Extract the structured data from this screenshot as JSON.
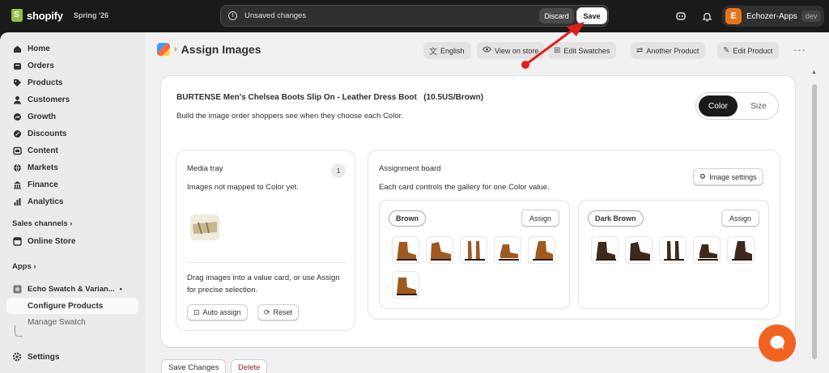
{
  "topbar": {
    "logo": "shopify",
    "version": "Spring '26",
    "unsaved_message": "Unsaved changes",
    "discard_label": "Discard",
    "save_label": "Save",
    "store_initial": "E",
    "store_name": "Echozer-Apps",
    "store_badge": "dev"
  },
  "sidebar": {
    "items": [
      {
        "label": "Home",
        "icon": "home-icon"
      },
      {
        "label": "Orders",
        "icon": "orders-icon"
      },
      {
        "label": "Products",
        "icon": "tag-icon"
      },
      {
        "label": "Customers",
        "icon": "person-icon"
      },
      {
        "label": "Growth",
        "icon": "growth-icon"
      },
      {
        "label": "Discounts",
        "icon": "discount-icon"
      },
      {
        "label": "Content",
        "icon": "content-icon"
      },
      {
        "label": "Markets",
        "icon": "globe-icon"
      },
      {
        "label": "Finance",
        "icon": "bank-icon"
      },
      {
        "label": "Analytics",
        "icon": "chart-icon"
      }
    ],
    "sales_channels_label": "Sales channels",
    "online_store_label": "Online Store",
    "apps_label": "Apps",
    "app_name": "Echo Swatch & Varian...",
    "configure_label": "Configure Products",
    "manage_label": "Manage Swatch"
  },
  "settings_label": "Settings",
  "header": {
    "title": "Assign Images",
    "buttons": [
      {
        "label": "English",
        "icon": "language-icon"
      },
      {
        "label": "View on store",
        "icon": "eye-icon"
      },
      {
        "label": "Edit Swatches",
        "icon": "swatch-icon"
      },
      {
        "label": "Another Product",
        "icon": "swap-icon"
      },
      {
        "label": "Edit Product",
        "icon": "pencil-icon"
      }
    ]
  },
  "product": {
    "title": "BURTENSE Men's Chelsea Boots Slip On - Leather Dress Boot   (10.5US/Brown)",
    "subtitle": "Build the image order shoppers see when they choose each Color.",
    "options": [
      "Color",
      "Size"
    ],
    "selected_option": "Color"
  },
  "tray": {
    "title": "Media tray",
    "count": "1",
    "subtitle": "Images not mapped to Color yet.",
    "help": "Drag images into a value card, or use Assign for precise selection.",
    "auto_assign_label": "Auto assign",
    "reset_label": "Reset"
  },
  "board": {
    "title": "Assignment board",
    "subtitle": "Each card controls the gallery for one Color value.",
    "settings_label": "Image settings",
    "assign_label": "Assign",
    "values": [
      {
        "name": "Brown",
        "image_count": 6,
        "color": "#a0591f"
      },
      {
        "name": "Dark Brown",
        "image_count": 5,
        "color": "#3d2a1c"
      }
    ]
  },
  "footer": {
    "save_changes_label": "Save Changes",
    "delete_label": "Delete"
  },
  "colors": {
    "accent": "#1a1a1a",
    "delete": "#8e1f0b",
    "arrow": "#e01e1e",
    "chat": "#f26322"
  }
}
